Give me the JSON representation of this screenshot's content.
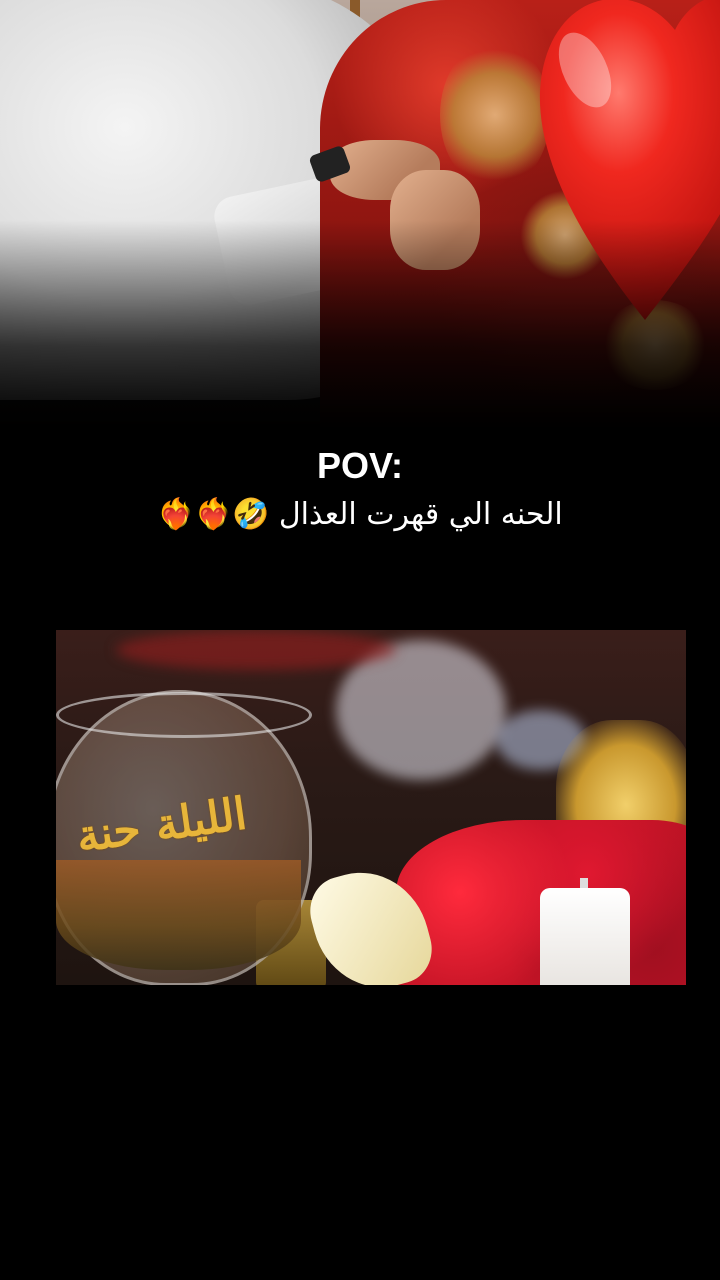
{
  "caption": {
    "title": "POV:",
    "line": "الحنه الي قهرت العذال 🤣❤️‍🔥❤️‍🔥"
  },
  "photos": {
    "top": {
      "heart_color": "#e8231f",
      "dress_color": "#b82018"
    },
    "bottom": {
      "bowl_text": "الليلة حنة",
      "feather_color": "#c41426"
    }
  },
  "colors": {
    "background": "#000000",
    "caption_text": "#ffffff"
  }
}
